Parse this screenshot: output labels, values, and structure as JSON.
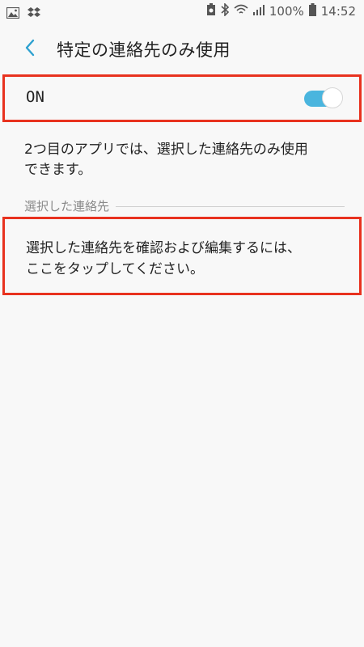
{
  "status_bar": {
    "battery": "100%",
    "time": "14:52",
    "icons": [
      "image-icon",
      "dropbox-icon",
      "battery-saver-icon",
      "bluetooth-icon",
      "wifi-icon",
      "signal-icon",
      "battery-icon"
    ]
  },
  "header": {
    "title": "特定の連絡先のみ使用",
    "back_icon": "chevron-left-icon"
  },
  "toggle_row": {
    "label": "ON",
    "state": true,
    "accent_color": "#4ab5de"
  },
  "description": "2つ目のアプリでは、選択した連絡先のみ使用\nできます。",
  "section": {
    "title": "選択した連絡先"
  },
  "edit_row": {
    "text": "選択した連絡先を確認および編集するには、\nここをタップしてください。"
  },
  "highlight_color": "#e8321f"
}
